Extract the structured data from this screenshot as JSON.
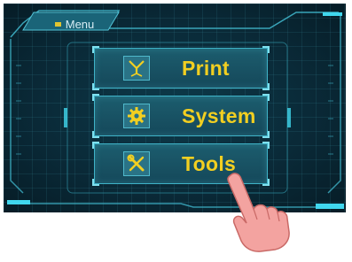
{
  "header": {
    "menu_label": "Menu"
  },
  "buttons": [
    {
      "label": "Print",
      "icon": "print-nozzle-icon"
    },
    {
      "label": "System",
      "icon": "gear-icon"
    },
    {
      "label": "Tools",
      "icon": "wrench-screwdriver-icon"
    }
  ],
  "colors": {
    "background": "#0a2a38",
    "accent_line": "#3fb3c8",
    "label_yellow": "#f2cf21",
    "button_fill": "#1c5d6e"
  }
}
